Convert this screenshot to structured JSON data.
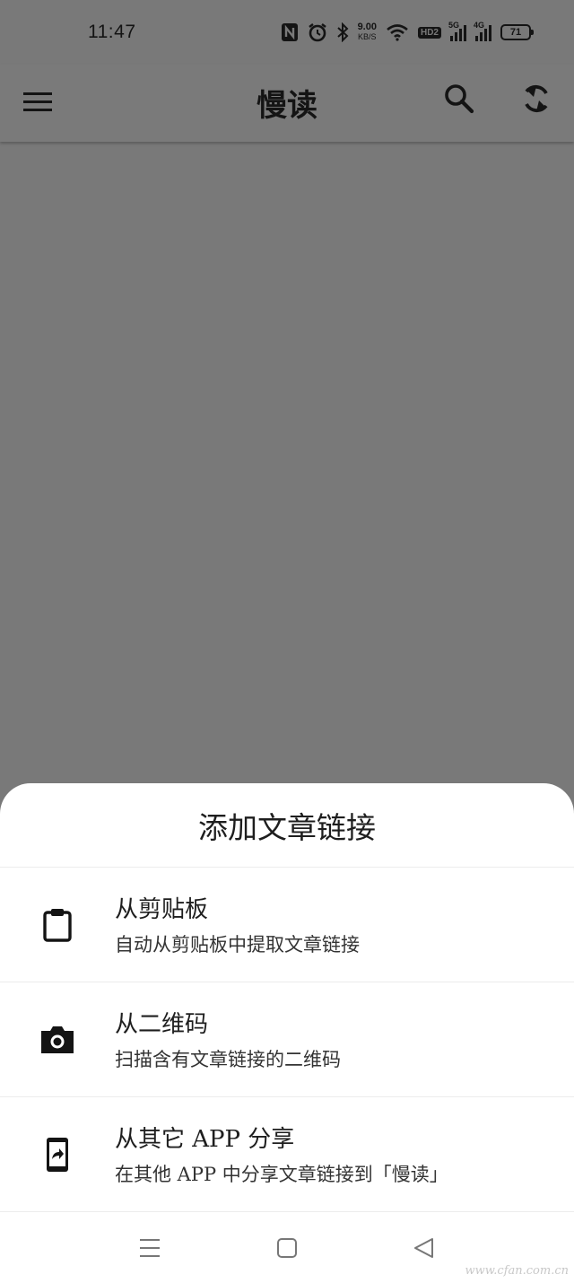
{
  "status_bar": {
    "time": "11:47",
    "net_speed_value": "9.00",
    "net_speed_unit": "KB/S",
    "hd_badge": "HD2",
    "signal_1_label": "5G",
    "signal_2_label": "4G",
    "battery": "71"
  },
  "app_bar": {
    "title": "慢读",
    "menu_icon": "menu-icon",
    "search_icon": "search-icon",
    "sync_icon": "sync-icon"
  },
  "sheet": {
    "title": "添加文章链接",
    "options": [
      {
        "label": "从剪贴板",
        "desc": "自动从剪贴板中提取文章链接",
        "icon": "clipboard-icon"
      },
      {
        "label": "从二维码",
        "desc": "扫描含有文章链接的二维码",
        "icon": "camera-icon"
      },
      {
        "label": "从其它 APP 分享",
        "desc": "在其他 APP 中分享文章链接到「慢读」",
        "icon": "phone-share-icon"
      }
    ]
  },
  "nav_bar": {
    "recents_icon": "recents-icon",
    "home_icon": "home-icon",
    "back_icon": "back-icon"
  },
  "watermark": "www.cfan.com.cn",
  "colors": {
    "scrim": "#797979",
    "sheet_bg": "#ffffff",
    "text_primary": "#1e1e1e",
    "icon": "#141414"
  }
}
